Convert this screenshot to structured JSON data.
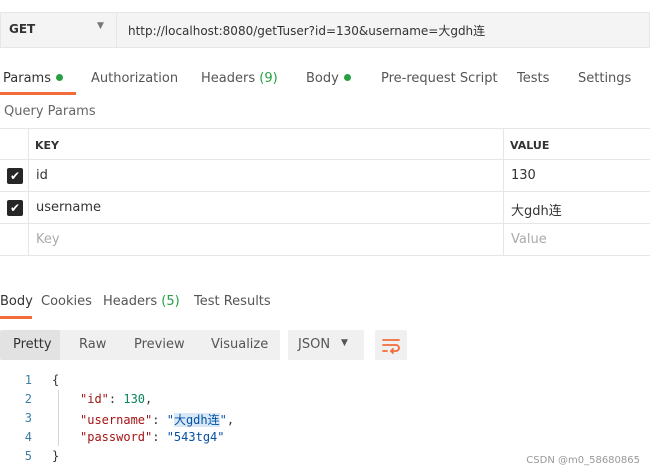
{
  "request": {
    "method": "GET",
    "url": "http://localhost:8080/getTuser?id=130&username=大gdh连"
  },
  "request_tabs": [
    {
      "label": "Params",
      "dot": true
    },
    {
      "label": "Authorization"
    },
    {
      "label": "Headers",
      "count": "(9)"
    },
    {
      "label": "Body",
      "dot": true
    },
    {
      "label": "Pre-request Script"
    },
    {
      "label": "Tests"
    },
    {
      "label": "Settings"
    }
  ],
  "query_params": {
    "title": "Query Params",
    "columns": [
      "KEY",
      "VALUE"
    ],
    "rows": [
      {
        "key": "id",
        "value": "130",
        "checked": true
      },
      {
        "key": "username",
        "value": "大gdh连",
        "checked": true
      }
    ],
    "placeholder_key": "Key",
    "placeholder_value": "Value"
  },
  "response_tabs": [
    {
      "label": "Body"
    },
    {
      "label": "Cookies"
    },
    {
      "label": "Headers",
      "count": "(5)"
    },
    {
      "label": "Test Results"
    }
  ],
  "view_modes": [
    "Pretty",
    "Raw",
    "Preview",
    "Visualize"
  ],
  "format": "JSON",
  "code": {
    "line_numbers": [
      "1",
      "2",
      "3",
      "4",
      "5"
    ],
    "open_brace": "{",
    "close_brace": "}",
    "fields": [
      {
        "key": "\"id\"",
        "colon": ": ",
        "value": "130",
        "trail": ","
      },
      {
        "key": "\"username\"",
        "colon": ": ",
        "value_pre": "\"",
        "value_hl": "大gdh连",
        "value_post": "\"",
        "trail": ","
      },
      {
        "key": "\"password\"",
        "colon": ": ",
        "value": "\"543tg4\"",
        "trail": ""
      }
    ]
  },
  "watermark": "CSDN @m0_58680865",
  "colors": {
    "accent": "#f26b3a",
    "success": "#26a043"
  },
  "icons": {
    "method_dropdown": "chevron-down-icon",
    "checkbox": "checkmark-icon",
    "wrap": "wrap-lines-icon"
  }
}
